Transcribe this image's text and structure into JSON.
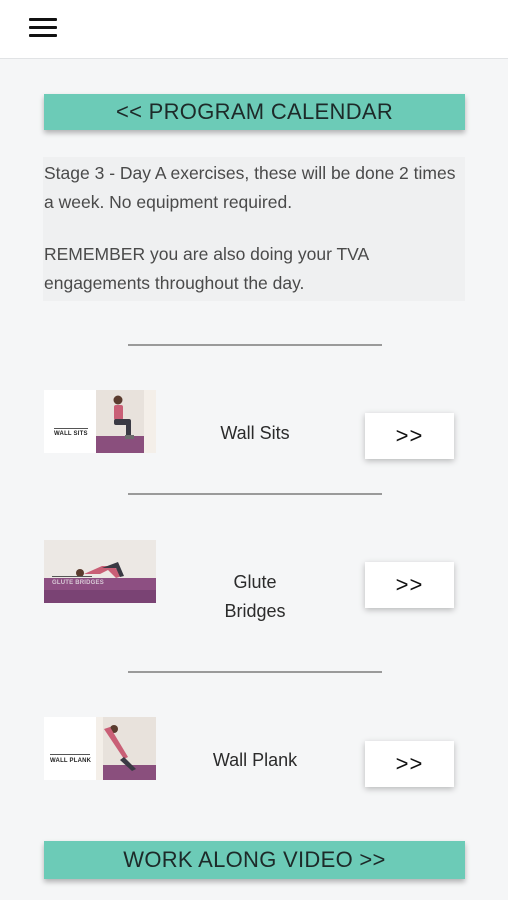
{
  "header": {
    "menu_icon": "hamburger-menu-icon"
  },
  "nav": {
    "calendar_label": "<< PROGRAM CALENDAR",
    "video_label": "WORK ALONG VIDEO >>"
  },
  "intro": {
    "paragraph1": "Stage 3 - Day A exercises, these will be done 2 times a week. No equipment required.",
    "paragraph2": "REMEMBER you are also doing your TVA engagements throughout the day."
  },
  "dividers": [
    "______________________________",
    "______________________________",
    "______________________________"
  ],
  "exercises": [
    {
      "name": "Wall Sits",
      "thumb_label": "WALL SITS",
      "button_label": ">>"
    },
    {
      "name": "Glute Bridges",
      "thumb_label": "GLUTE BRIDGES",
      "button_label": ">>"
    },
    {
      "name": "Wall Plank",
      "thumb_label": "WALL PLANK",
      "button_label": ">>"
    }
  ],
  "colors": {
    "accent": "#6ccbb7",
    "background": "#f5f6f7",
    "info_box": "#eff0f1"
  }
}
